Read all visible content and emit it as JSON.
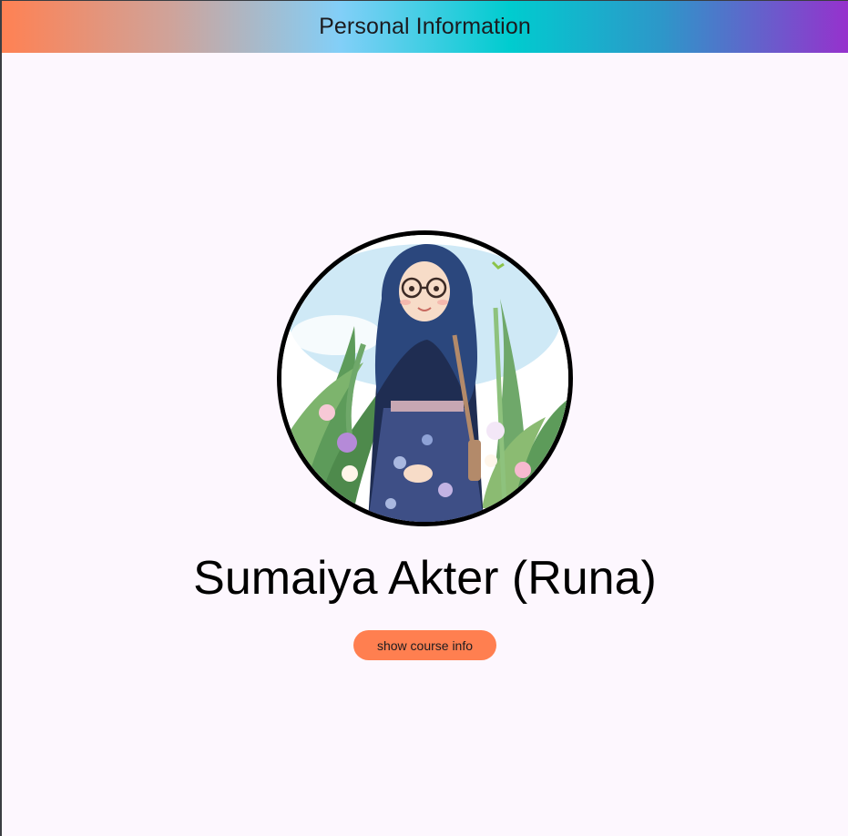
{
  "appbar": {
    "title": "Personal Information"
  },
  "profile": {
    "name": "Sumaiya Akter (Runa)",
    "avatar_icon": "profile-illustration",
    "button_label": "show course info"
  },
  "colors": {
    "background": "#fdf7fe",
    "button": "#ff7f50",
    "appbar_gradient": [
      "#ff8153",
      "#82cff8",
      "#00cccf",
      "#9631cd"
    ]
  }
}
